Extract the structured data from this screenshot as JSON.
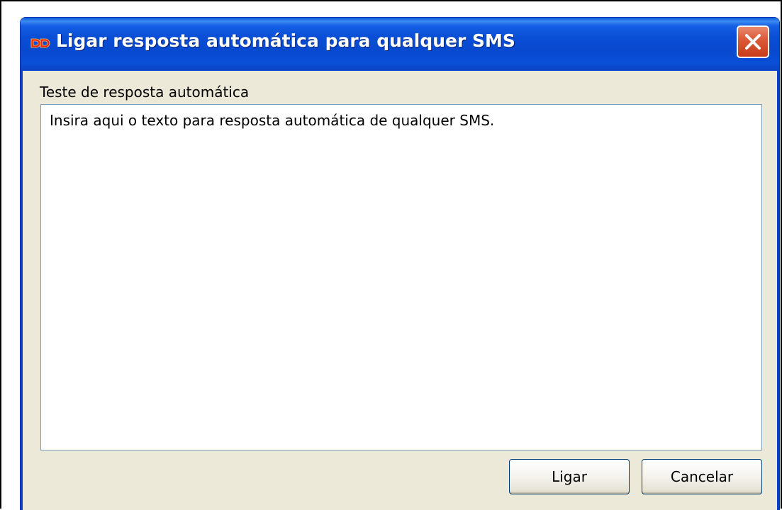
{
  "window": {
    "title": "Ligar resposta automática para qualquer SMS",
    "app_icon": "app-icon",
    "close_icon": "close-icon"
  },
  "form": {
    "label": "Teste de resposta automática",
    "text_value": "Insira aqui o texto para resposta automática de qualquer SMS."
  },
  "buttons": {
    "ok_label": "Ligar",
    "cancel_label": "Cancelar"
  },
  "colors": {
    "titlebar": "#0a4fd6",
    "dialog_background": "#ece9d8",
    "close_button": "#dc5b3a"
  }
}
